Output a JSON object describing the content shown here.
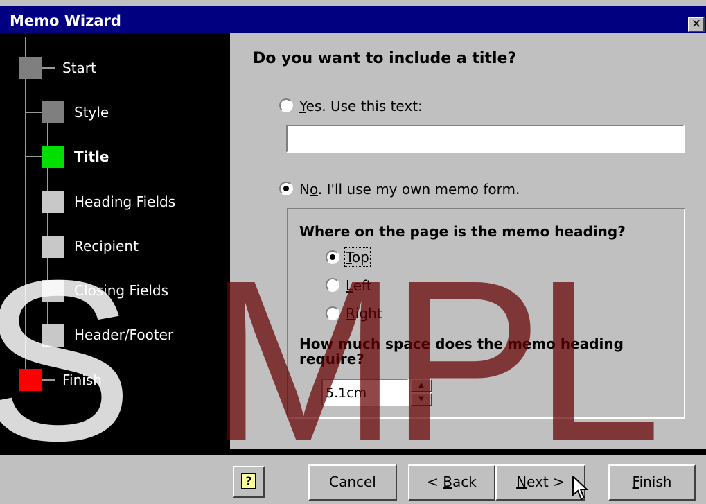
{
  "window": {
    "title": "Memo Wizard",
    "close_label": "✕"
  },
  "steps": [
    {
      "label": "Start"
    },
    {
      "label": "Style"
    },
    {
      "label": "Title"
    },
    {
      "label": "Heading Fields"
    },
    {
      "label": "Recipient"
    },
    {
      "label": "Closing Fields"
    },
    {
      "label": "Header/Footer"
    },
    {
      "label": "Finish"
    }
  ],
  "main": {
    "question": "Do you want to include a title?",
    "yes_option": {
      "accel": "Y",
      "rest": "es.  Use this text:",
      "checked": false
    },
    "title_text_value": "",
    "no_option": {
      "pre": "N",
      "accel": "o",
      "rest": ".  I'll use my own memo form.",
      "checked": true
    },
    "heading_question": "Where on the page is the memo heading?",
    "positions": [
      {
        "accel": "T",
        "rest": "op",
        "checked": true
      },
      {
        "accel": "L",
        "rest": "eft",
        "checked": false
      },
      {
        "accel": "R",
        "rest": "ight",
        "checked": false
      }
    ],
    "space_question_line1": "How much space does the memo heading",
    "space_question_line2": "require?",
    "space_value": "5.1cm"
  },
  "footer": {
    "help_label": "?",
    "cancel_label": "Cancel",
    "back": {
      "pre": "< ",
      "accel": "B",
      "rest": "ack"
    },
    "next": {
      "accel": "N",
      "rest": "ext >"
    },
    "finish": {
      "accel": "F",
      "rest": "inish"
    }
  },
  "watermark": {
    "text_main": "MPL",
    "text_left": "S"
  },
  "colors": {
    "title_bar": "#000080",
    "panel": "#000000",
    "current_step": "#00e000",
    "finish_step": "#ff0000",
    "dialog_face": "#c0c0c0",
    "watermark": "#640000"
  }
}
